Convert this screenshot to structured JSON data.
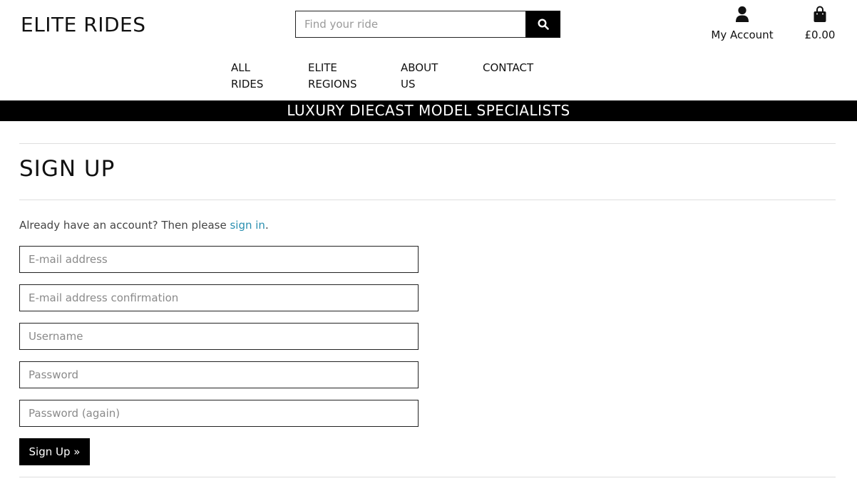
{
  "header": {
    "logo": "ELITE RIDES",
    "search": {
      "placeholder": "Find your ride",
      "button_icon": "search-icon"
    },
    "account": {
      "label": "My Account",
      "icon": "user-icon"
    },
    "bag": {
      "total": "£0.00",
      "icon": "shopping-bag-icon"
    }
  },
  "nav": {
    "items": [
      {
        "line1": "ALL",
        "line2": "RIDES"
      },
      {
        "line1": "ELITE",
        "line2": "REGIONS"
      },
      {
        "line1": "ABOUT",
        "line2": "US"
      },
      {
        "line1": "CONTACT",
        "line2": ""
      }
    ]
  },
  "banner": {
    "text": "LUXURY DIECAST MODEL SPECIALISTS"
  },
  "main": {
    "title": "SIGN UP",
    "prompt_text": "Already have an account? Then please ",
    "prompt_link": "sign in",
    "prompt_end": ".",
    "fields": [
      {
        "placeholder": "E-mail address",
        "value": ""
      },
      {
        "placeholder": "E-mail address confirmation",
        "value": ""
      },
      {
        "placeholder": "Username",
        "value": ""
      },
      {
        "placeholder": "Password",
        "value": ""
      },
      {
        "placeholder": "Password (again)",
        "value": ""
      }
    ],
    "submit_label": "Sign Up »"
  },
  "colors": {
    "link": "#2a8fb0",
    "banner_bg": "#000000",
    "button_bg": "#000000"
  }
}
